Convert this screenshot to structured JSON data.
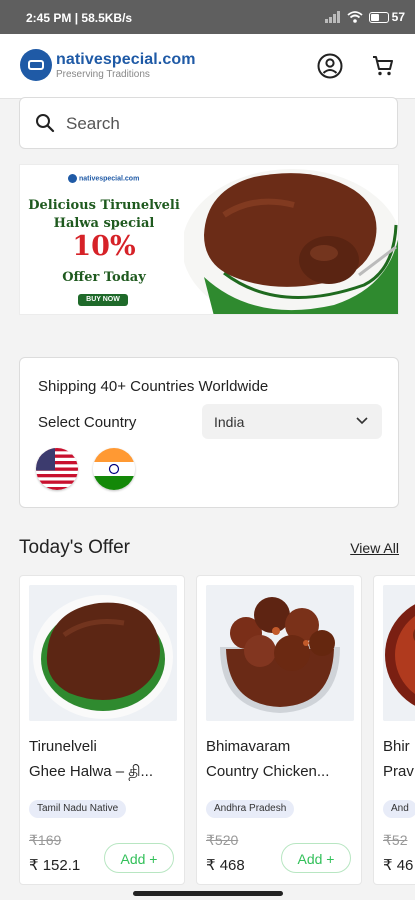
{
  "status": {
    "time": "2:45 PM",
    "speed": "58.5KB/s",
    "battery": "57",
    "battery_level": 0.57
  },
  "header": {
    "brand": "nativespecial.com",
    "tagline": "Preserving Traditions"
  },
  "search": {
    "placeholder": "Search"
  },
  "banner": {
    "mini_logo": "nativespecial.com",
    "line1": "Delicious Tirunelveli",
    "line1b": "Halwa special",
    "discount": "10%",
    "line3": "Offer Today",
    "cta": "BUY NOW"
  },
  "shipping": {
    "title": "Shipping 40+ Countries Worldwide",
    "select_label": "Select Country",
    "selected_country": "India",
    "flags": [
      "us-flag",
      "india-flag"
    ]
  },
  "offers": {
    "title": "Today's Offer",
    "view_all": "View All",
    "products": [
      {
        "name1": "Tirunelveli",
        "name2": "Ghee Halwa – தி...",
        "tag": "Tamil Nadu Native",
        "mrp": "₹169",
        "price": "₹ 152.1",
        "add": "Add +"
      },
      {
        "name1": "Bhimavaram",
        "name2": "Country Chicken...",
        "tag": "Andhra Pradesh",
        "mrp": "₹520",
        "price": "₹ 468",
        "add": "Add +"
      },
      {
        "name1": "Bhir",
        "name2": "Prav",
        "tag": "And",
        "mrp": "₹52",
        "price": "₹ 46"
      }
    ]
  },
  "colors": {
    "brand": "#1f5aa6",
    "add_green": "#33c05a",
    "banner_red": "#d62228",
    "banner_green": "#1f5a1f"
  }
}
